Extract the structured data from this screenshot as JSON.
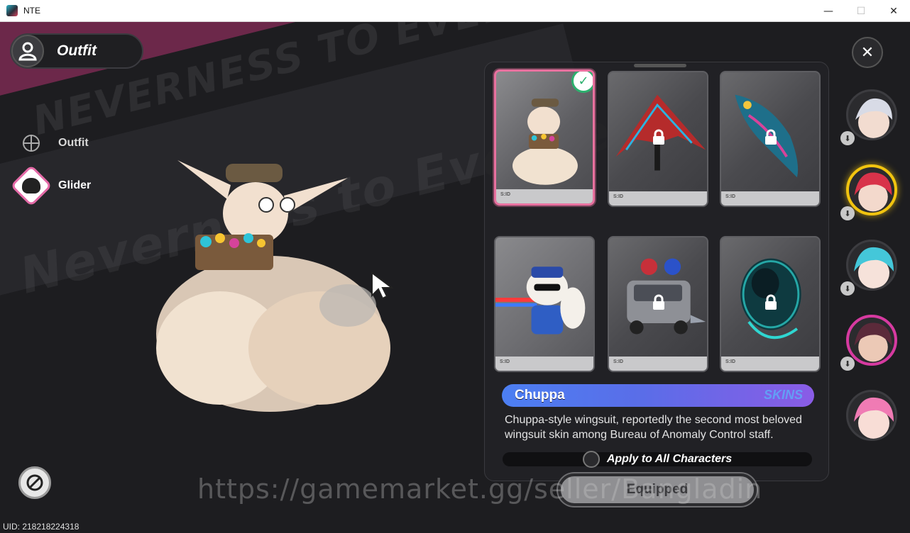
{
  "window": {
    "title": "NTE",
    "minimize": "—",
    "maximize": "☐",
    "close": "✕"
  },
  "header": {
    "title": "Outfit",
    "icon": "person-icon"
  },
  "nav": {
    "items": [
      {
        "label": "Outfit",
        "icon": "crosshair-icon",
        "active": false
      },
      {
        "label": "Glider",
        "icon": "glider-icon",
        "active": true
      }
    ]
  },
  "background_text": {
    "line1": "NEVERNESS TO EVERNESS",
    "line2": "Neverness to Everness"
  },
  "skins": {
    "cards": [
      {
        "name": "Chuppa",
        "locked": false,
        "equipped": true,
        "tag": "S:ID"
      },
      {
        "name": "",
        "locked": true,
        "equipped": false,
        "tag": "S:ID"
      },
      {
        "name": "",
        "locked": true,
        "equipped": false,
        "tag": "S:ID"
      },
      {
        "name": "",
        "locked": false,
        "equipped": false,
        "tag": "S:ID"
      },
      {
        "name": "",
        "locked": true,
        "equipped": false,
        "tag": "S:ID"
      },
      {
        "name": "",
        "locked": true,
        "equipped": false,
        "tag": "S:ID"
      }
    ],
    "check_mark": "✓",
    "selected": {
      "name": "Chuppa",
      "category": "SKINS",
      "description": "Chuppa-style wingsuit, reportedly the second most beloved wingsuit skin among Bureau of Anomaly Control staff."
    }
  },
  "apply_all": {
    "label": "Apply to All Characters",
    "checked": false
  },
  "equip_button": {
    "label": "Equipped"
  },
  "close_button": "✕",
  "characters": {
    "download_icon": "⬇",
    "items": [
      {
        "id": "char-1",
        "hair": "#d8dbe6",
        "active": false
      },
      {
        "id": "char-2",
        "hair": "#d8334a",
        "active": true
      },
      {
        "id": "char-3",
        "hair": "#44c7d9",
        "active": false
      },
      {
        "id": "char-4",
        "hair": "#5b2a3a",
        "active": false
      },
      {
        "id": "char-5",
        "hair": "#f07bb4",
        "active": false
      }
    ]
  },
  "watermark": "https://gamemarket.gg/seller/Bangladin",
  "uid": "UID: 218218224318",
  "colors": {
    "accent_pink": "#e9719f",
    "equipped_check": "#2db06e",
    "name_bar_start": "#4c7ff2",
    "name_bar_end": "#8a5ce6",
    "active_character": "#f1c40f"
  }
}
